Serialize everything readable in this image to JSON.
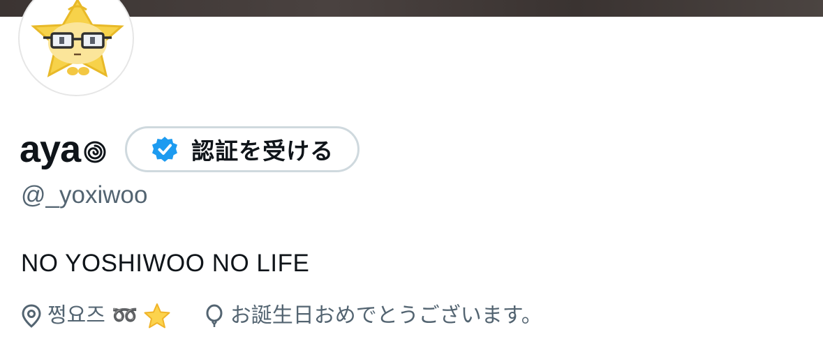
{
  "profile": {
    "display_name": "aya",
    "name_emoji_icon": "cyclone-spiral-icon",
    "handle": "@_yoxiwoo",
    "bio": "NO YOSHIWOO NO LIFE",
    "avatar_icon": "star-character-with-glasses-avatar"
  },
  "verify_button": {
    "label": "認証を受ける",
    "icon": "verified-badge-icon",
    "accent_color": "#1d9bf0"
  },
  "meta": {
    "location": {
      "icon": "location-pin-icon",
      "text": "쩡요즈 ➿",
      "emoji_icon": "star-emoji-icon"
    },
    "birthday": {
      "icon": "balloon-icon",
      "text": "お誕生日おめでとうございます。"
    }
  },
  "colors": {
    "text_primary": "#0f1419",
    "text_secondary": "#536471",
    "button_border": "#cfd9de",
    "banner": "#3f3836"
  }
}
